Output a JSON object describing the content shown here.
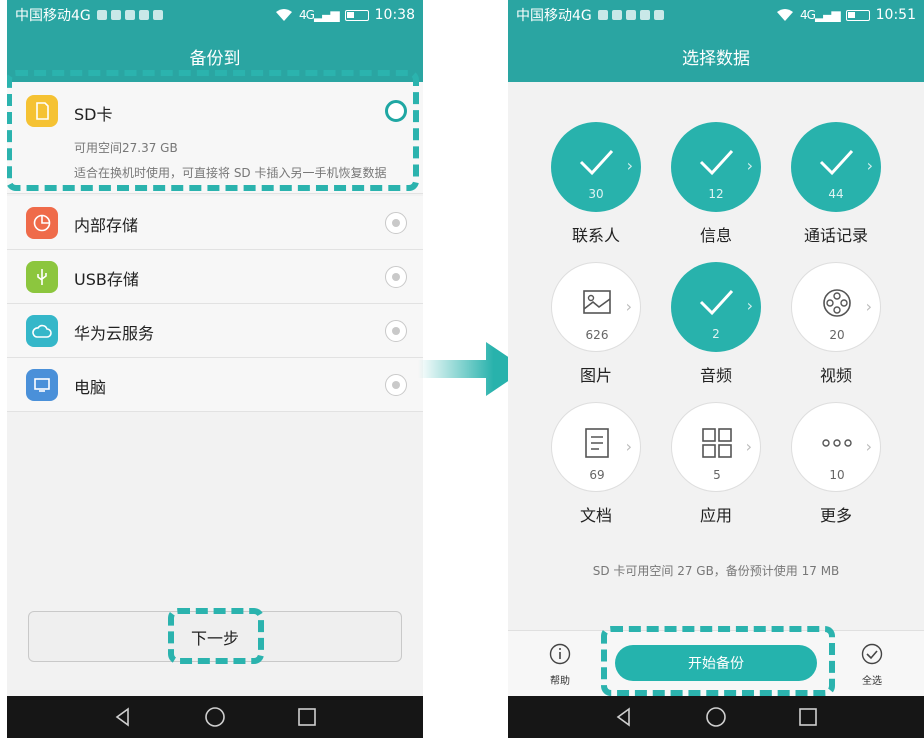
{
  "left_screen": {
    "status": {
      "carrier": "中国移动4G",
      "time": "10:38",
      "net": "4G"
    },
    "title": "备份到",
    "options": [
      {
        "label": "SD卡",
        "space": "可用空间27.37 GB",
        "desc": "适合在换机时使用，可直接将 SD 卡插入另一手机恢复数据",
        "selected": true,
        "icon": "sd-card-icon",
        "color": "#f5c233"
      },
      {
        "label": "内部存储",
        "selected": false,
        "icon": "pie-chart-icon",
        "color": "#ef6b4a"
      },
      {
        "label": "USB存储",
        "selected": false,
        "icon": "usb-icon",
        "color": "#8cc63e"
      },
      {
        "label": "华为云服务",
        "selected": false,
        "icon": "cloud-icon",
        "color": "#35b7c9"
      },
      {
        "label": "电脑",
        "selected": false,
        "icon": "monitor-icon",
        "color": "#4a90d9"
      }
    ],
    "next_label": "下一步"
  },
  "right_screen": {
    "status": {
      "carrier": "中国移动4G",
      "time": "10:51",
      "net": "4G"
    },
    "title": "选择数据",
    "items": [
      {
        "label": "联系人",
        "count": "30",
        "selected": true
      },
      {
        "label": "信息",
        "count": "12",
        "selected": true
      },
      {
        "label": "通话记录",
        "count": "44",
        "selected": true
      },
      {
        "label": "图片",
        "count": "626",
        "selected": false,
        "icon": "image-icon"
      },
      {
        "label": "音频",
        "count": "2",
        "selected": true
      },
      {
        "label": "视频",
        "count": "20",
        "selected": false,
        "icon": "film-reel-icon"
      },
      {
        "label": "文档",
        "count": "69",
        "selected": false,
        "icon": "document-icon"
      },
      {
        "label": "应用",
        "count": "5",
        "selected": false,
        "icon": "apps-grid-icon"
      },
      {
        "label": "更多",
        "count": "10",
        "selected": false,
        "icon": "more-dots-icon"
      }
    ],
    "storage_note": "SD 卡可用空间 27 GB，备份预计使用 17 MB",
    "help_label": "帮助",
    "start_label": "开始备份",
    "select_all_label": "全选"
  },
  "colors": {
    "teal": "#2aa5a2",
    "accent": "#28b2ac",
    "highlight": "#2bb3ae"
  }
}
